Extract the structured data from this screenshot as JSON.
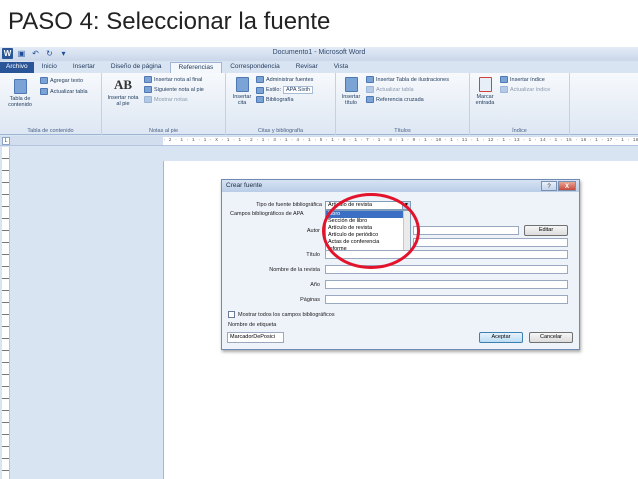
{
  "slide": {
    "title": "PASO 4: Seleccionar la fuente"
  },
  "window": {
    "title": "Documento1  -  Microsoft Word"
  },
  "tabs": [
    {
      "label": "Archivo"
    },
    {
      "label": "Inicio"
    },
    {
      "label": "Insertar"
    },
    {
      "label": "Diseño de página"
    },
    {
      "label": "Referencias"
    },
    {
      "label": "Correspondencia"
    },
    {
      "label": "Revisar"
    },
    {
      "label": "Vista"
    }
  ],
  "ribbon": {
    "toc": {
      "big": "Tabla de contenido",
      "add_text": "Agregar texto",
      "update": "Actualizar tabla",
      "label": "Tabla de contenido"
    },
    "notes": {
      "big_icon": "AB",
      "big": "Insertar nota al pie",
      "endnote": "Insertar nota al final",
      "next": "Siguiente nota al pie",
      "show": "Mostrar notas",
      "label": "Notas al pie"
    },
    "citations": {
      "big": "Insertar cita",
      "manage": "Administrar fuentes",
      "style_label": "Estilo:",
      "style_value": "APA Sixth",
      "bibliography": "Bibliografía",
      "label": "Citas y bibliografía"
    },
    "captions": {
      "big": "Insertar título",
      "insert_table": "Insertar Tabla de ilustraciones",
      "update": "Actualizar tabla",
      "cross_ref": "Referencia cruzada",
      "label": "Títulos"
    },
    "index": {
      "big": "Marcar entrada",
      "insert": "Insertar índice",
      "update": "Actualizar índice",
      "label": "Índice"
    }
  },
  "ruler": {
    "text": "· 2 · 1 · 1 · 1 · X · 1 · 1 · 2 · 1 · 3 · 1 · 4 · 1 · 5 · 1 · 6 · 1 · 7 · 1 · 8 · 1 · 9 · 1 · 10 · 1 · 11 · 1 · 12 · 1 · 13 · 1 · 14 · 1 · 15 · 16 · 1 · 17 · 1 · 18"
  },
  "dialog": {
    "title": "Crear fuente",
    "help": "?",
    "close": "X",
    "source_type_label": "Tipo de fuente bibliográfica",
    "source_type_value": "Artículo de revista",
    "fields_label": "Campos bibliográficos de APA",
    "options": [
      "Libro",
      "Sección de libro",
      "Artículo de revista",
      "Artículo de periódico",
      "Actas de conferencia",
      "Informe"
    ],
    "author_label": "Autor",
    "edit_button": "Editar",
    "title_label": "Título",
    "journal_label": "Nombre de la revista",
    "year_label": "Año",
    "pages_label": "Páginas",
    "show_all": "Mostrar todos los campos bibliográficos",
    "tag_label": "Nombre de etiqueta",
    "tag_value": "MarcadorDePosici",
    "ok": "Aceptar",
    "cancel": "Cancelar"
  },
  "colors": {
    "highlight": "#e2132b",
    "selection": "#3a6fc4",
    "file_tab": "#2a5699"
  }
}
